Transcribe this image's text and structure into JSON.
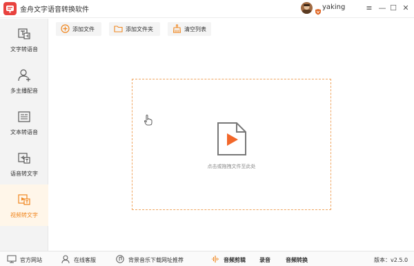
{
  "app": {
    "title": "金舟文字语音转换软件",
    "username": "yaking",
    "accent": "#f0861e",
    "logo_color": "#e8423e"
  },
  "window": {
    "menu": "≡",
    "minimize": "—",
    "maximize": "☐",
    "close": "✕"
  },
  "sidebar": {
    "items": [
      {
        "label": "文字转语音",
        "icon": "text-to-speech-icon",
        "active": false
      },
      {
        "label": "多主播配音",
        "icon": "multi-anchor-icon",
        "active": false
      },
      {
        "label": "文本转语音",
        "icon": "document-to-speech-icon",
        "active": false
      },
      {
        "label": "语音转文字",
        "icon": "speech-to-text-icon",
        "active": false
      },
      {
        "label": "视频转文字",
        "icon": "video-to-text-icon",
        "active": true
      }
    ]
  },
  "toolbar": {
    "add_file": "添加文件",
    "add_folder": "添加文件夹",
    "clear_list": "清空列表"
  },
  "dropzone": {
    "hint": "点击或拖拽文件至此处"
  },
  "statusbar": {
    "website": "官方网站",
    "support": "在线客服",
    "music": "背景音乐下载网址推荐",
    "audio_edit": "音频剪辑",
    "record": "录音",
    "audio_convert": "音频转换",
    "version": "版本：v2.5.0"
  }
}
